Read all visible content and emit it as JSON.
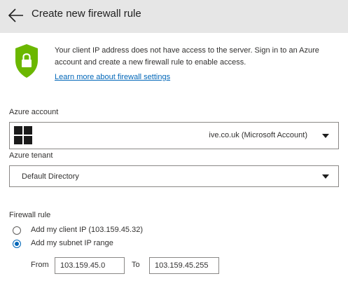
{
  "header": {
    "back_icon": "arrow-left-icon",
    "title": "Create new firewall rule"
  },
  "info": {
    "icon": "shield-lock-icon",
    "shield_color": "#6bb700",
    "message": "Your client IP address does not have access to the server. Sign in to an Azure account and create a new firewall rule to enable access.",
    "link_text": "Learn more about firewall settings"
  },
  "account": {
    "label": "Azure account",
    "icon": "microsoft-logo-icon",
    "value": "ive.co.uk (Microsoft Account)",
    "dropdown_icon": "chevron-down-icon"
  },
  "tenant": {
    "label": "Azure tenant",
    "value": "Default Directory",
    "dropdown_icon": "chevron-down-icon"
  },
  "firewall_rule": {
    "label": "Firewall rule",
    "options": [
      {
        "label": "Add my client IP (103.159.45.32)",
        "selected": false
      },
      {
        "label": "Add my subnet IP range",
        "selected": true
      }
    ],
    "from_label": "From",
    "from_value": "103.159.45.0",
    "to_label": "To",
    "to_value": "103.159.45.255"
  },
  "colors": {
    "accent": "#0066b8",
    "header_bg": "#e6e6e6"
  }
}
